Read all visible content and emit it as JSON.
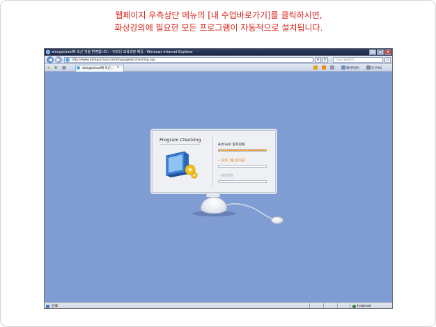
{
  "caption": {
    "line1": "웹페이지 우측상단 메뉴의 [내 수업바로가기]를 클릭하시면,",
    "line2": "화상강의에 필요한 모든 프로그램이 자동적으로 설치됩니다."
  },
  "browser": {
    "title": "elongschool에 오신 것을 환영합니다. - 이러닝 교육과정 제공 - Windows Internet Explorer",
    "window_buttons": {
      "minimize": "_",
      "maximize": "□",
      "close": "x"
    },
    "nav": {
      "back": "◀",
      "forward": "▶"
    },
    "address": "http://www.elongschool.com/mypage/pcchecking.asp",
    "search_placeholder": "Live Search",
    "tab_label": "elongschool에 오신...",
    "tab_close": "x",
    "toolbar": {
      "page": "페이지(P)",
      "tools": "도구(O)"
    },
    "status_text": "완료",
    "zone_text": "Internet"
  },
  "dialog": {
    "title": "Program Checking",
    "rows": [
      {
        "label": "ActiveX 설치완료",
        "fill": 1.0,
        "color": "#222222"
      },
      {
        "label": "프로그램 설치중",
        "fill": 0.0,
        "color": "#e07a12"
      },
      {
        "label": "서버연결",
        "fill": 0.0,
        "color": "#9aa0aa"
      }
    ]
  },
  "colors": {
    "caption": "#d8241c",
    "desktop": "#7f9cd3",
    "progress": "#f09a2e"
  }
}
